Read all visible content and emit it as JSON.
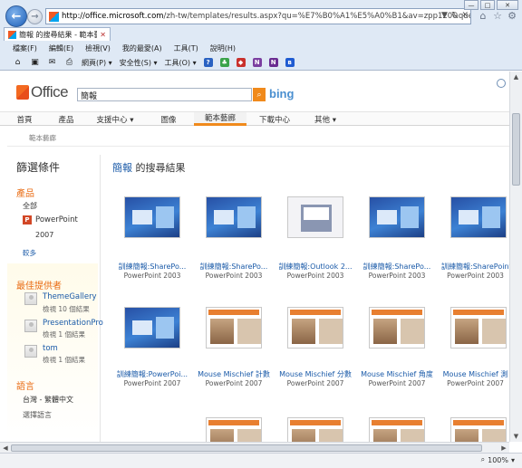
{
  "browser": {
    "url_prefix": "http://office.microsoft.com",
    "url_rest": "/zh-tw/templates/results.aspx?qu=%E7%B0%A1%E5%A0%B1&av=zpp120&queryid=a7157dbf",
    "addr_tools": [
      "▼",
      "↻",
      "✕"
    ],
    "tab_title": "簡報 的搜尋結果 - 範本藝廊...",
    "window_buttons": [
      "—",
      "□",
      "✕"
    ],
    "right_icons": [
      "⌂",
      "☆",
      "⚙"
    ],
    "menu": [
      "檔案(F)",
      "編輯(E)",
      "檢視(V)",
      "我的最愛(A)",
      "工具(T)",
      "說明(H)"
    ],
    "toolbar": [
      "網頁(P) ▾",
      "安全性(S) ▾",
      "工具(O) ▾"
    ],
    "zoom": "100%"
  },
  "site": {
    "logo_text": "Office",
    "search_value": "簡報",
    "bing_text": "bing",
    "nav": [
      "首頁",
      "產品",
      "支援中心 ▾",
      "圖像",
      "範本藝廊",
      "下載中心",
      "其他 ▾"
    ],
    "breadcrumb": "範本藝廊"
  },
  "sidebar": {
    "title": "篩選條件",
    "products_head": "產品",
    "all": "全部",
    "ppt": "PowerPoint",
    "ppt_version": "2007",
    "fewer": "較多",
    "providers_head": "最佳提供者",
    "providers": [
      {
        "name": "ThemeGallery",
        "count": "檢視 10 個結果"
      },
      {
        "name": "PresentationPro",
        "count": "檢視 1 個結果"
      },
      {
        "name": "tom",
        "count": "檢視 1 個結果"
      }
    ],
    "lang_head": "語言",
    "lang_value": "台灣 - 繁體中文",
    "lang_select": "選擇語言"
  },
  "results": {
    "keyword": "簡報",
    "suffix": " 的搜尋結果",
    "row1": [
      {
        "title": "訓練簡報:SharePo...",
        "sub": "PowerPoint 2003"
      },
      {
        "title": "訓練簡報:SharePo...",
        "sub": "PowerPoint 2003"
      },
      {
        "title": "訓練簡報:Outlook 2...",
        "sub": "PowerPoint 2003"
      },
      {
        "title": "訓練簡報:SharePo...",
        "sub": "PowerPoint 2003"
      },
      {
        "title": "訓練簡報:SharePoint",
        "sub": "PowerPoint 2003"
      }
    ],
    "row2": [
      {
        "title": "訓練簡報:PowerPoi...",
        "sub": "PowerPoint 2007"
      },
      {
        "title": "Mouse Mischief 計數",
        "sub": "PowerPoint 2007"
      },
      {
        "title": "Mouse Mischief 分數",
        "sub": "PowerPoint 2007"
      },
      {
        "title": "Mouse Mischief 角度",
        "sub": "PowerPoint 2007"
      },
      {
        "title": "Mouse Mischief 測",
        "sub": "PowerPoint 2007"
      }
    ]
  }
}
